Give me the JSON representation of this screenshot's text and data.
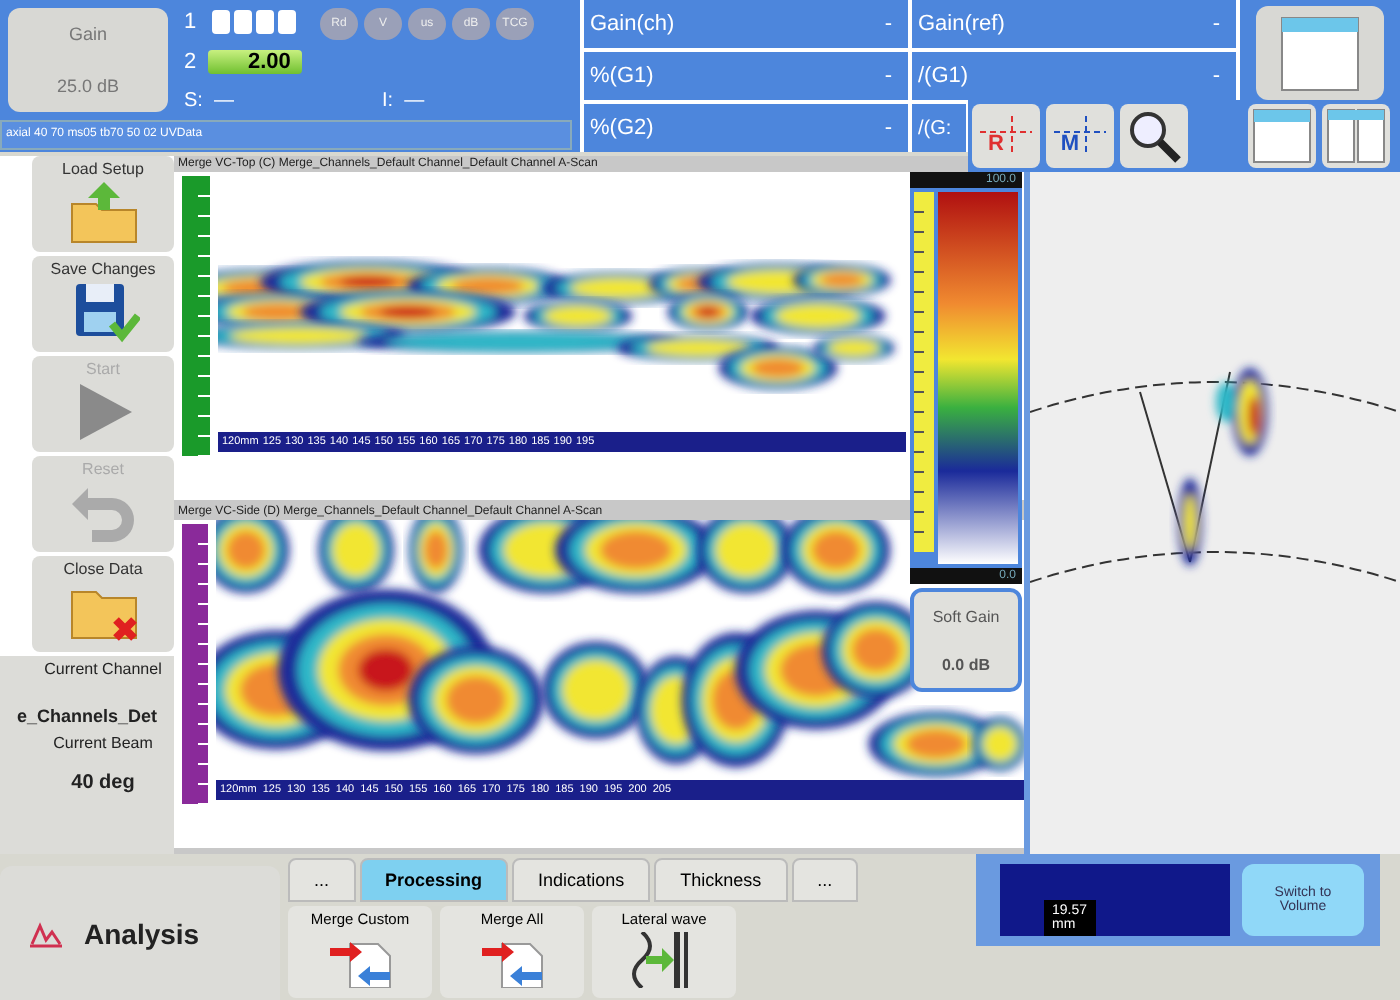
{
  "gain": {
    "label": "Gain",
    "value": "25.0 dB"
  },
  "channels": [
    {
      "label": "1",
      "kind": "segments"
    },
    {
      "label": "2",
      "kind": "value",
      "value": "2.00"
    }
  ],
  "readouts": [
    {
      "label": "S:",
      "value": "—"
    },
    {
      "label": "I:",
      "value": "—"
    }
  ],
  "unit_buttons": [
    "Rd",
    "V",
    "us",
    "dB",
    "TCG"
  ],
  "status_line": "axial 40 70 ms05 tb70 50 02 UVData",
  "fields": [
    {
      "label": "Gain(ch)",
      "value": "-"
    },
    {
      "label": "Gain(ref)",
      "value": "-"
    },
    {
      "label": "%(G1)",
      "value": "-"
    },
    {
      "label": "/(G1)",
      "value": "-"
    },
    {
      "label": "%(G2)",
      "value": "-"
    },
    {
      "label": "/(G:"
    }
  ],
  "toolbar": [
    {
      "kind": "cursor",
      "letter": "R"
    },
    {
      "kind": "cursor",
      "letter": "M"
    },
    {
      "kind": "zoom"
    }
  ],
  "sidebar": [
    {
      "kind": "load",
      "label": "Load Setup",
      "disabled": false
    },
    {
      "kind": "save",
      "label": "Save Changes",
      "disabled": false
    },
    {
      "kind": "start",
      "label": "Start",
      "disabled": true
    },
    {
      "kind": "reset",
      "label": "Reset",
      "disabled": true
    },
    {
      "kind": "close",
      "label": "Close Data",
      "disabled": false
    }
  ],
  "current_channel": {
    "label": "Current Channel",
    "value": "e_Channels_Det"
  },
  "current_beam": {
    "label": "Current Beam",
    "value": "40 deg"
  },
  "scans": [
    {
      "title": "Merge VC-Top (C) Merge_Channels_Default Channel_Default Channel A-Scan",
      "x_ticks": [
        "120mm",
        "125",
        "130",
        "135",
        "140",
        "145",
        "150",
        "155",
        "160",
        "165",
        "170",
        "175",
        "180",
        "185",
        "190",
        "195"
      ]
    },
    {
      "title": "Merge VC-Side (D) Merge_Channels_Default Channel_Default Channel A-Scan",
      "x_ticks": [
        "120mm",
        "125",
        "130",
        "135",
        "140",
        "145",
        "150",
        "155",
        "160",
        "165",
        "170",
        "175",
        "180",
        "185",
        "190",
        "195",
        "200",
        "205"
      ]
    }
  ],
  "color_bar": {
    "max": "100.0",
    "min": "0.0"
  },
  "soft_gain": {
    "label": "Soft Gain",
    "value": "0.0 dB"
  },
  "mode": {
    "label": "Analysis"
  },
  "tabs": [
    {
      "label": "...",
      "selected": false
    },
    {
      "label": "Processing",
      "selected": true
    },
    {
      "label": "Indications",
      "selected": false
    },
    {
      "label": "Thickness",
      "selected": false
    },
    {
      "label": "...",
      "selected": false
    }
  ],
  "actions": [
    {
      "kind": "merge_custom",
      "label": "Merge Custom"
    },
    {
      "kind": "merge_all",
      "label": "Merge All"
    },
    {
      "kind": "lateral",
      "label": "Lateral wave"
    }
  ],
  "position": {
    "value": "19.57",
    "unit": "mm"
  },
  "switch_button": "Switch to Volume"
}
